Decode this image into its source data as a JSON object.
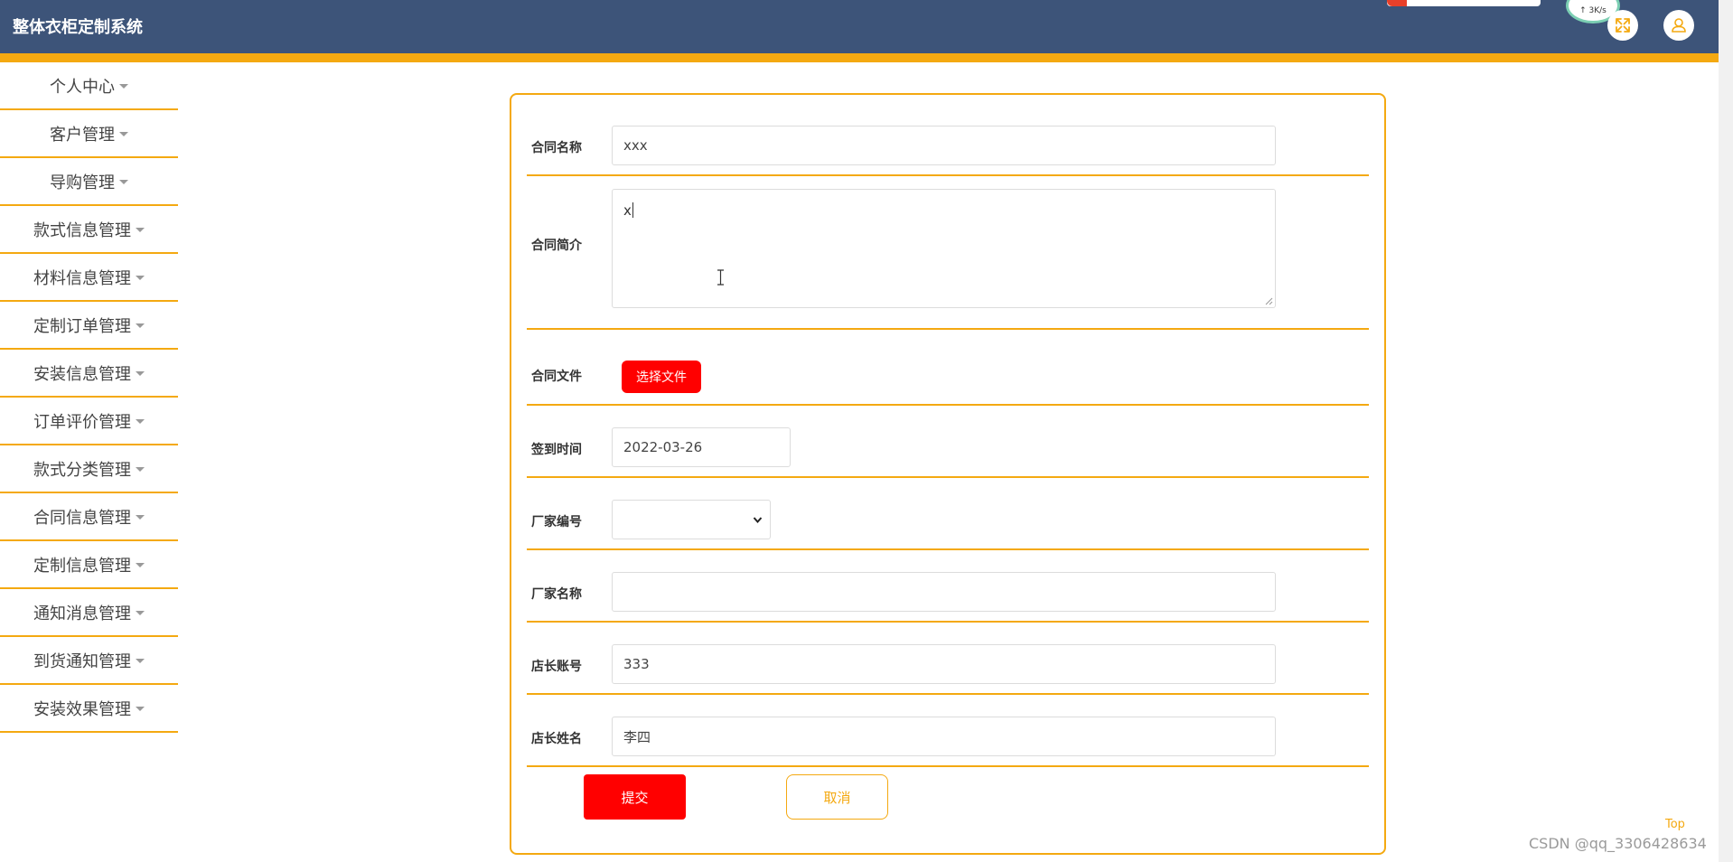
{
  "app": {
    "title": "整体衣柜定制系统"
  },
  "sidebar": {
    "items": [
      {
        "label": "个人中心"
      },
      {
        "label": "客户管理"
      },
      {
        "label": "导购管理"
      },
      {
        "label": "款式信息管理"
      },
      {
        "label": "材料信息管理"
      },
      {
        "label": "定制订单管理"
      },
      {
        "label": "安装信息管理"
      },
      {
        "label": "订单评价管理"
      },
      {
        "label": "款式分类管理"
      },
      {
        "label": "合同信息管理"
      },
      {
        "label": "定制信息管理"
      },
      {
        "label": "通知消息管理"
      },
      {
        "label": "到货通知管理"
      },
      {
        "label": "安装效果管理"
      }
    ]
  },
  "header_widget": {
    "speed": "↑ 3K/s"
  },
  "form": {
    "contract_name": {
      "label": "合同名称",
      "value": "xxx"
    },
    "contract_intro": {
      "label": "合同简介",
      "value": "x"
    },
    "contract_file": {
      "label": "合同文件",
      "button": "选择文件"
    },
    "sign_date": {
      "label": "签到时间",
      "value": "2022-03-26"
    },
    "factory_no": {
      "label": "厂家编号",
      "value": ""
    },
    "factory_name": {
      "label": "厂家名称",
      "value": ""
    },
    "manager_account": {
      "label": "店长账号",
      "value": "333"
    },
    "manager_name": {
      "label": "店长姓名",
      "value": "李四"
    },
    "submit_label": "提交",
    "cancel_label": "取消"
  },
  "footer": {
    "top_label": "Top",
    "watermark": "CSDN @qq_3306428634"
  },
  "colors": {
    "header_bg": "#3d5479",
    "accent": "#f4a911",
    "primary_button": "#ff0000"
  }
}
